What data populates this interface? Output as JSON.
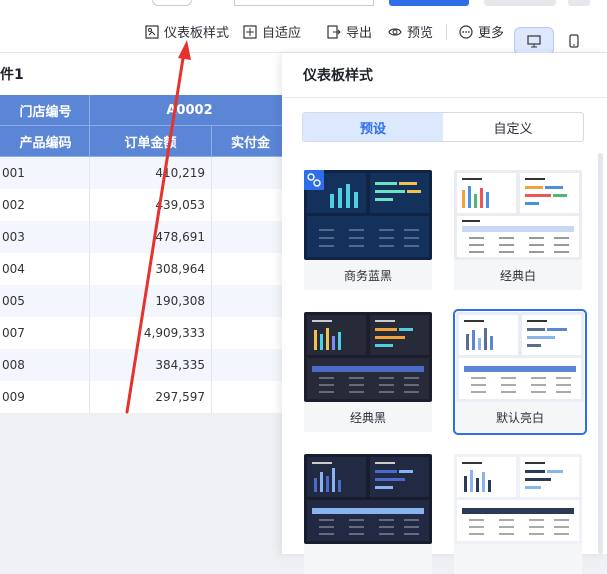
{
  "toolbar": {
    "dashboard_style_label": "仪表板样式",
    "adaptive_label": "自适应",
    "export_label": "导出",
    "preview_label": "预览",
    "more_label": "更多"
  },
  "component": {
    "title": "件1"
  },
  "table": {
    "header_row1": [
      "门店编号",
      "A0002"
    ],
    "header_row2": [
      "产品编码",
      "订单金额",
      "实付金"
    ],
    "rows": [
      [
        "001",
        "410,219"
      ],
      [
        "002",
        "439,053"
      ],
      [
        "003",
        "478,691"
      ],
      [
        "004",
        "308,964"
      ],
      [
        "005",
        "190,308"
      ],
      [
        "007",
        "4,909,333"
      ],
      [
        "008",
        "384,335"
      ],
      [
        "009",
        "297,597"
      ]
    ]
  },
  "panel": {
    "title": "仪表板样式",
    "tabs": [
      "预设",
      "自定义"
    ],
    "active_tab": "预设",
    "themes": [
      {
        "label": "商务蓝黑",
        "tone": "dark-blue"
      },
      {
        "label": "经典白",
        "tone": "white"
      },
      {
        "label": "经典黑",
        "tone": "black"
      },
      {
        "label": "默认亮白",
        "tone": "light",
        "selected": true
      },
      {
        "label": "",
        "tone": "navy"
      },
      {
        "label": "",
        "tone": "white-blue"
      }
    ]
  },
  "colors": {
    "accent": "#2f6eea",
    "header_blue": "#5b86d6",
    "arrow_red": "#e5322d"
  }
}
